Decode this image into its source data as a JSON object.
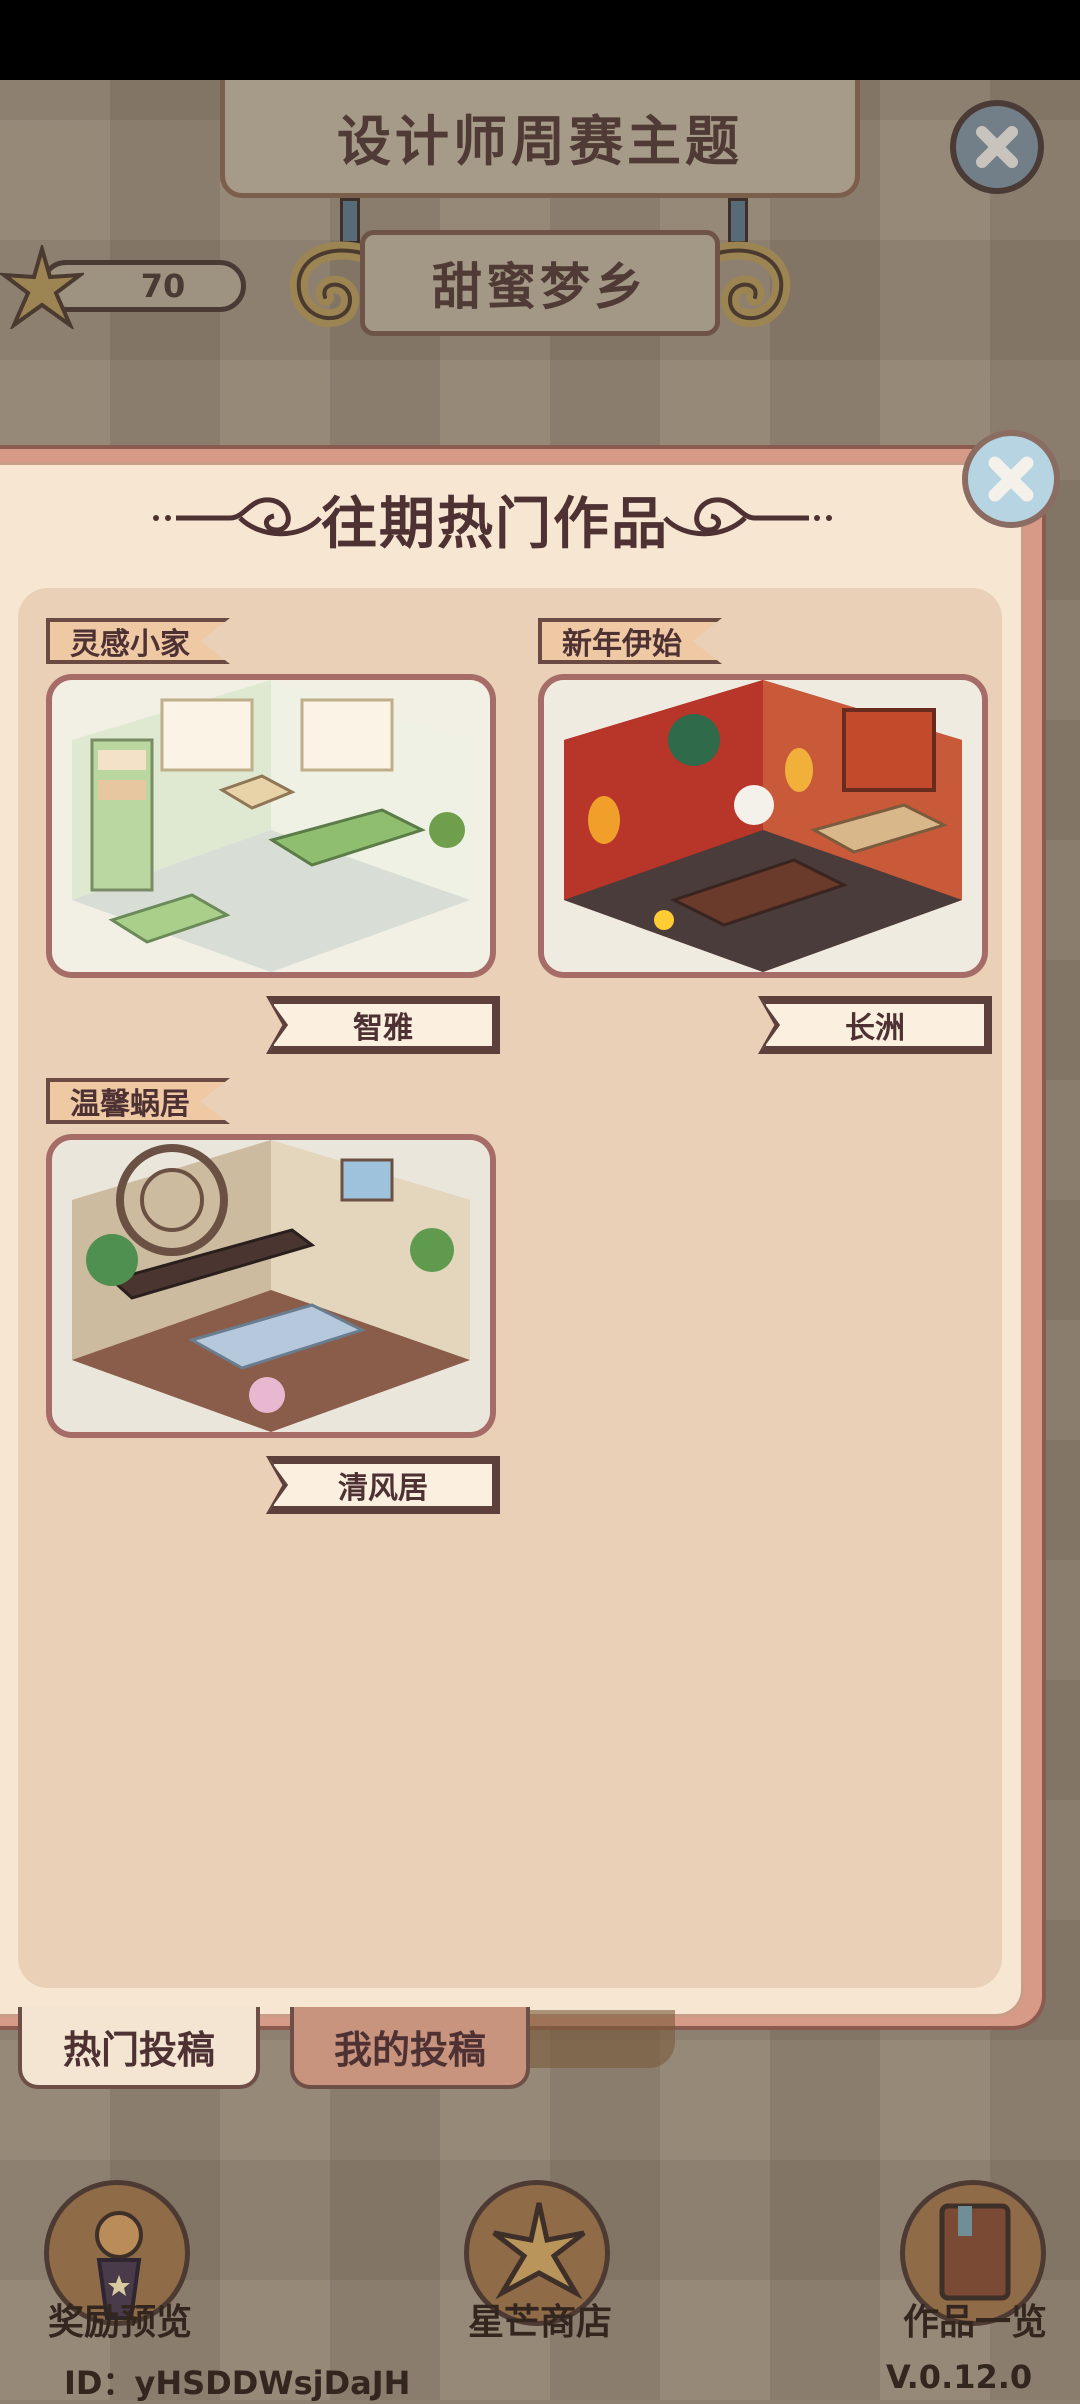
{
  "header": {
    "title": "设计师周赛主题",
    "theme": "甜蜜梦乡",
    "star_count": "70"
  },
  "panel": {
    "title": "往期热门作品",
    "works": [
      {
        "tag": "灵感小家",
        "author": "智雅",
        "scene": "mint-green study room with bookshelves, sofa and desk"
      },
      {
        "tag": "新年伊始",
        "author": "长洲",
        "scene": "red new-year room with lanterns, lion dance decor and tea table"
      },
      {
        "tag": "温馨蜗居",
        "author": "清风居",
        "scene": "chinese style room with round lattice window, bench and plants"
      }
    ]
  },
  "tabs": [
    {
      "label": "热门投稿",
      "active": true
    },
    {
      "label": "我的投稿",
      "active": false
    }
  ],
  "nav": {
    "rewards": "奖励预览",
    "shop": "星芒商店",
    "works": "作品一览"
  },
  "footer": {
    "user_id": "ID：yHSDDWsjDaJH",
    "version": "V.0.12.0"
  },
  "colors": {
    "panel_bg": "#f6e6d2",
    "content_bg": "#e9d0b6",
    "text_dark": "#4e3133",
    "accent_border": "#a66c68"
  }
}
